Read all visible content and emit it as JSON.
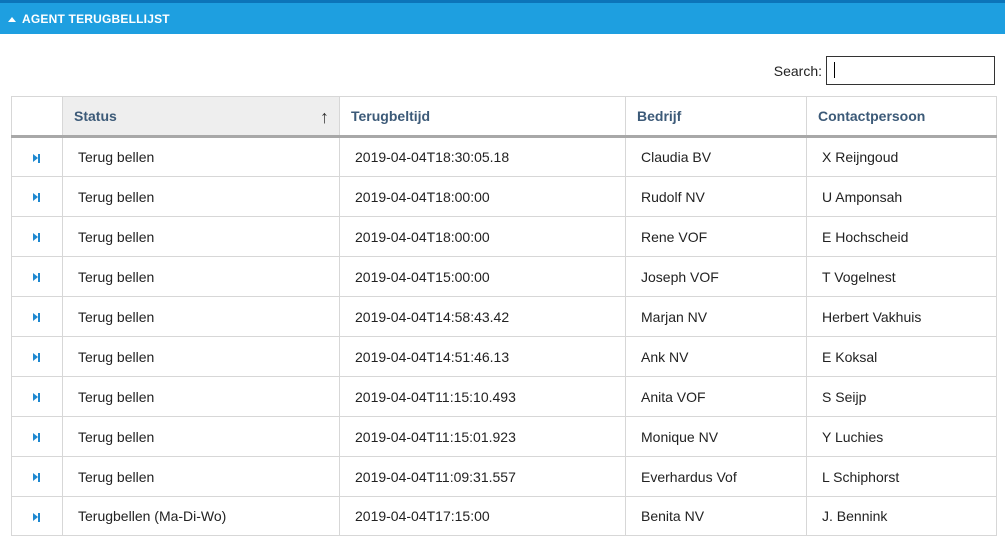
{
  "panel": {
    "title": "AGENT TERUGBELLIJST"
  },
  "search": {
    "label": "Search:",
    "value": ""
  },
  "table": {
    "columns": [
      "",
      "Status",
      "Terugbeltijd",
      "Bedrijf",
      "Contactpersoon"
    ],
    "sorted_column": "Status",
    "sort_direction": "ascending",
    "rows": [
      {
        "status": "Terug bellen",
        "terugbeltijd": "2019-04-04T18:30:05.18",
        "bedrijf": "Claudia BV",
        "contactpersoon": "X Reijngoud"
      },
      {
        "status": "Terug bellen",
        "terugbeltijd": "2019-04-04T18:00:00",
        "bedrijf": "Rudolf NV",
        "contactpersoon": "U Amponsah"
      },
      {
        "status": "Terug bellen",
        "terugbeltijd": "2019-04-04T18:00:00",
        "bedrijf": "Rene VOF",
        "contactpersoon": "E Hochscheid"
      },
      {
        "status": "Terug bellen",
        "terugbeltijd": "2019-04-04T15:00:00",
        "bedrijf": "Joseph VOF",
        "contactpersoon": "T Vogelnest"
      },
      {
        "status": "Terug bellen",
        "terugbeltijd": "2019-04-04T14:58:43.42",
        "bedrijf": "Marjan NV",
        "contactpersoon": "Herbert Vakhuis"
      },
      {
        "status": "Terug bellen",
        "terugbeltijd": "2019-04-04T14:51:46.13",
        "bedrijf": "Ank NV",
        "contactpersoon": "E Koksal"
      },
      {
        "status": "Terug bellen",
        "terugbeltijd": "2019-04-04T11:15:10.493",
        "bedrijf": "Anita VOF",
        "contactpersoon": "S Seijp"
      },
      {
        "status": "Terug bellen",
        "terugbeltijd": "2019-04-04T11:15:01.923",
        "bedrijf": "Monique NV",
        "contactpersoon": "Y Luchies"
      },
      {
        "status": "Terug bellen",
        "terugbeltijd": "2019-04-04T11:09:31.557",
        "bedrijf": "Everhardus Vof",
        "contactpersoon": "L Schiphorst"
      },
      {
        "status": "Terugbellen (Ma-Di-Wo)",
        "terugbeltijd": "2019-04-04T17:15:00",
        "bedrijf": "Benita NV",
        "contactpersoon": "J. Bennink"
      }
    ]
  },
  "colors": {
    "header_bar": "#1e9fe0",
    "header_text": "#3c5a78",
    "row_icon": "#1e88d0"
  },
  "icons": {
    "collapse": "triangle-up-icon",
    "sort": "arrow-up-icon",
    "row_action": "play-next-icon"
  }
}
